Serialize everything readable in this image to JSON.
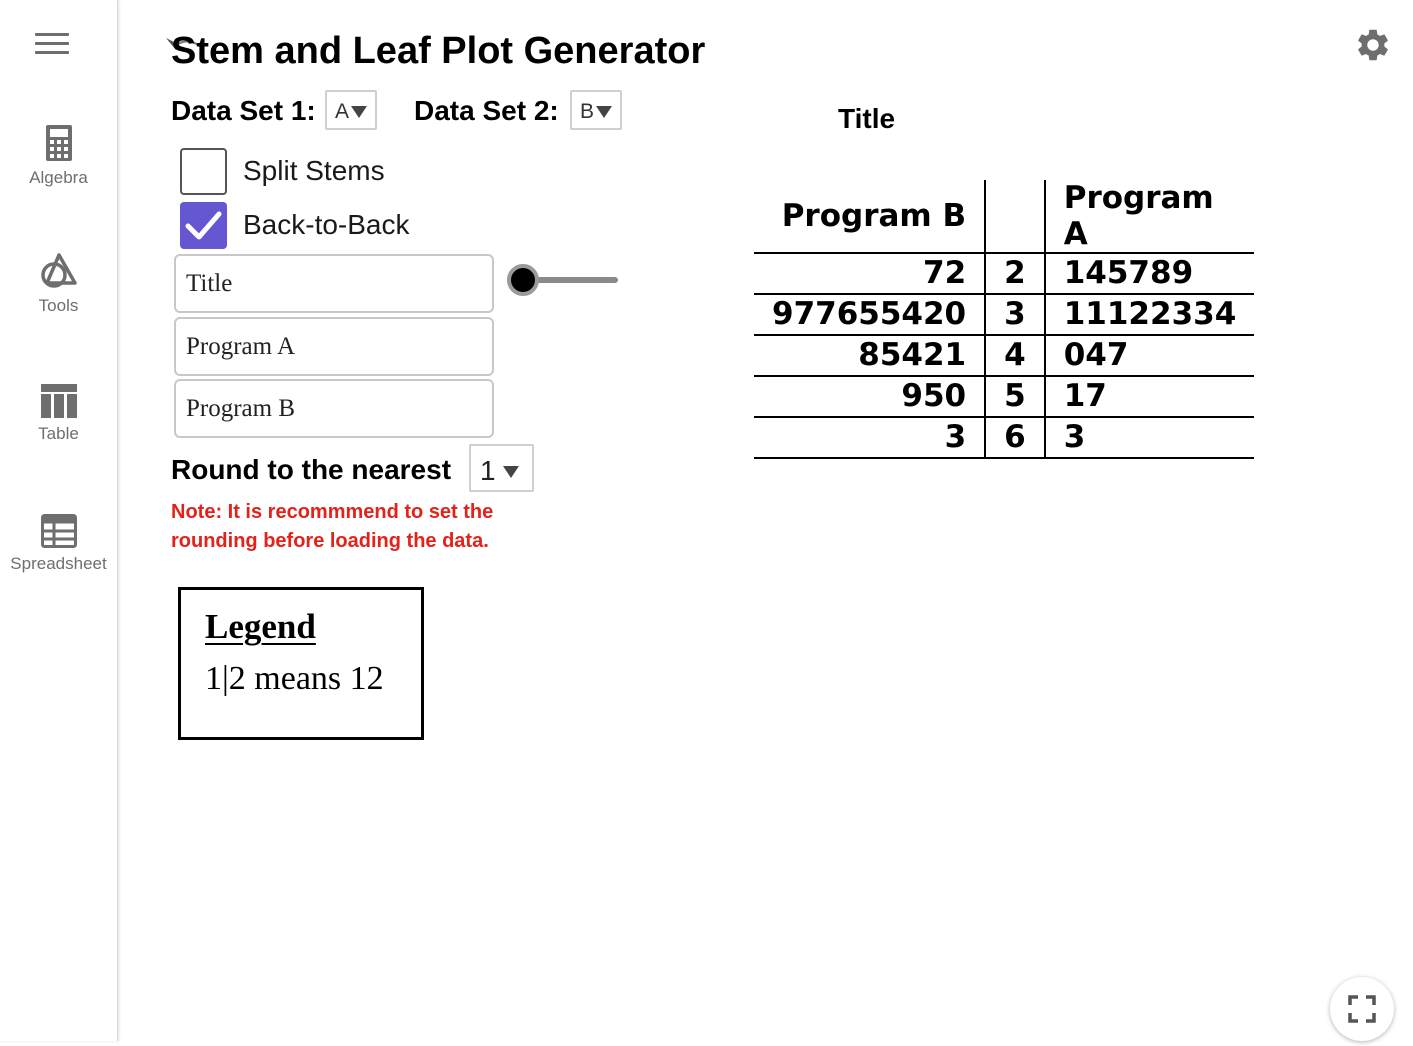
{
  "sidebar": {
    "items": [
      {
        "label": "Algebra",
        "icon": "calculator-icon"
      },
      {
        "label": "Tools",
        "icon": "shapes-icon"
      },
      {
        "label": "Table",
        "icon": "table-icon"
      },
      {
        "label": "Spreadsheet",
        "icon": "spreadsheet-icon"
      }
    ]
  },
  "header": {
    "title": "Stem and Leaf Plot Generator"
  },
  "controls": {
    "dataset1_label": "Data Set 1:",
    "dataset1_value": "A",
    "dataset2_label": "Data Set 2:",
    "dataset2_value": "B",
    "split_stems_label": "Split Stems",
    "split_stems_checked": false,
    "back_to_back_label": "Back-to-Back",
    "back_to_back_checked": true,
    "title_field": "Title",
    "program_a_field": "Program A",
    "program_b_field": "Program B",
    "slider_value": 0,
    "round_label": "Round to the nearest",
    "round_value": "1",
    "note_line1": "Note: It is recommmend to set the",
    "note_line2": "rounding before loading the data."
  },
  "legend": {
    "title": "Legend",
    "text": "1|2 means 12"
  },
  "plot": {
    "title": "Title",
    "left_header": "Program B",
    "right_header": "Program A",
    "rows": [
      {
        "left": "72",
        "stem": "2",
        "right": "145789"
      },
      {
        "left": "977655420",
        "stem": "3",
        "right": "11122334"
      },
      {
        "left": "85421",
        "stem": "4",
        "right": "047"
      },
      {
        "left": "950",
        "stem": "5",
        "right": "17"
      },
      {
        "left": "3",
        "stem": "6",
        "right": "3"
      }
    ]
  },
  "colors": {
    "accent": "#6557d2",
    "note": "#e3221a",
    "sidebar_text": "#6e6e6e"
  }
}
